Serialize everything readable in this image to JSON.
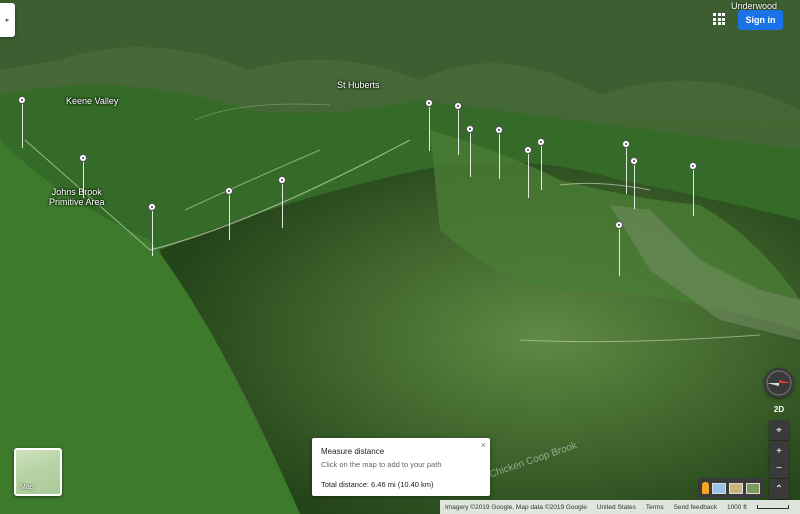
{
  "map": {
    "view": "satellite 3D terrain",
    "labels": {
      "keene_valley": "Keene Valley",
      "st_huberts": "St Huberts",
      "johns_brook": "Johns Brook\nPrimitive Area",
      "underwood": "Underwood",
      "chicken_coop_brook": "Chicken Coop Brook"
    },
    "marker_count": 16
  },
  "header": {
    "sign_in_label": "Sign in",
    "apps_icon": "apps-grid-icon"
  },
  "side_panel": {
    "toggle_glyph": "▸"
  },
  "measure": {
    "title": "Measure distance",
    "hint": "Click on the map to add to your path",
    "total": "Total distance: 6.46 mi (10.40 km)",
    "close_glyph": "×"
  },
  "thumbnail": {
    "label": "Map"
  },
  "controls": {
    "two_d_label": "2D",
    "locate_glyph": "⌖",
    "zoom_in_glyph": "+",
    "zoom_out_glyph": "−",
    "expand_glyph": "⌃"
  },
  "footer": {
    "imagery": "Imagery ©2019 Google, Map data ©2019 Google",
    "country": "United States",
    "terms": "Terms",
    "feedback": "Send feedback",
    "scale": "1000 ft"
  }
}
